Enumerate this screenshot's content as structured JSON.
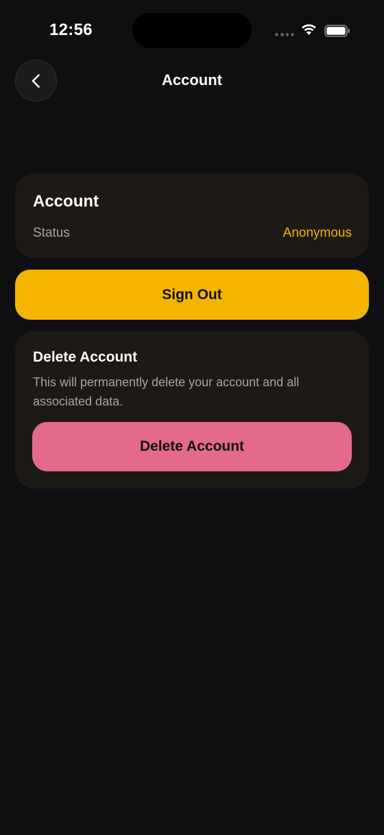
{
  "status_bar": {
    "time": "12:56",
    "icons": [
      "signal-dots-icon",
      "wifi-icon",
      "battery-icon"
    ]
  },
  "header": {
    "back_icon": "chevron-left-icon",
    "title": "Account"
  },
  "account_card": {
    "title": "Account",
    "status_label": "Status",
    "status_value": "Anonymous"
  },
  "sign_out": {
    "label": "Sign Out"
  },
  "delete_card": {
    "title": "Delete Account",
    "description": "This will permanently delete your account and all associated data.",
    "button_label": "Delete Account"
  },
  "colors": {
    "background": "#0f0f11",
    "card_background": "#1d1a16",
    "accent_yellow": "#f4b400",
    "status_value": "#f3b300",
    "danger_pink": "#e46a8a",
    "muted_text": "#a6a4a0"
  }
}
